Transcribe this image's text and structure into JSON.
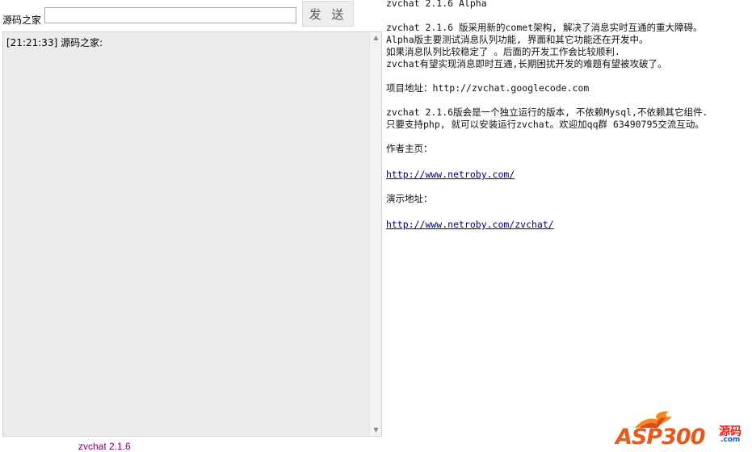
{
  "chat": {
    "name_label": "源码之家",
    "input_value": "",
    "send_label": "发 送",
    "messages": [
      {
        "time": "[21:21:33]",
        "text": "源码之家:"
      }
    ],
    "version": "zvchat 2.1.6"
  },
  "info": {
    "heading": "zvchat 2.1.6 Alpha",
    "para1": [
      "zvchat 2.1.6 版采用新的comet架构, 解决了消息实时互通的重大障碍。",
      "Alpha版主要测试消息队列功能, 界面和其它功能还在开发中。",
      "如果消息队列比较稳定了 。后面的开发工作会比较顺利.",
      "zvchat有望实现消息即时互通,长期困扰开发的难题有望被攻破了。"
    ],
    "project_line": "项目地址：http://zvchat.googlecode.com",
    "para2": [
      "zvchat 2.1.6版会是一个独立运行的版本, 不依赖Mysql,不依赖其它组件.",
      "只要支持php, 就可以安装运行zvchat。欢迎加qq群 63490795交流互动。"
    ],
    "author_label": "作者主页：",
    "author_link": "http://www.netroby.com/",
    "demo_label": "演示地址：",
    "demo_link": "http://www.netroby.com/zvchat/"
  },
  "logo": {
    "brand": "ASP300",
    "cn": "源码",
    "com": ".com"
  },
  "colors": {
    "chat_bg": "#ececec",
    "link": "#000080",
    "version": "#800080",
    "logo_orange": "#e75a1c"
  }
}
